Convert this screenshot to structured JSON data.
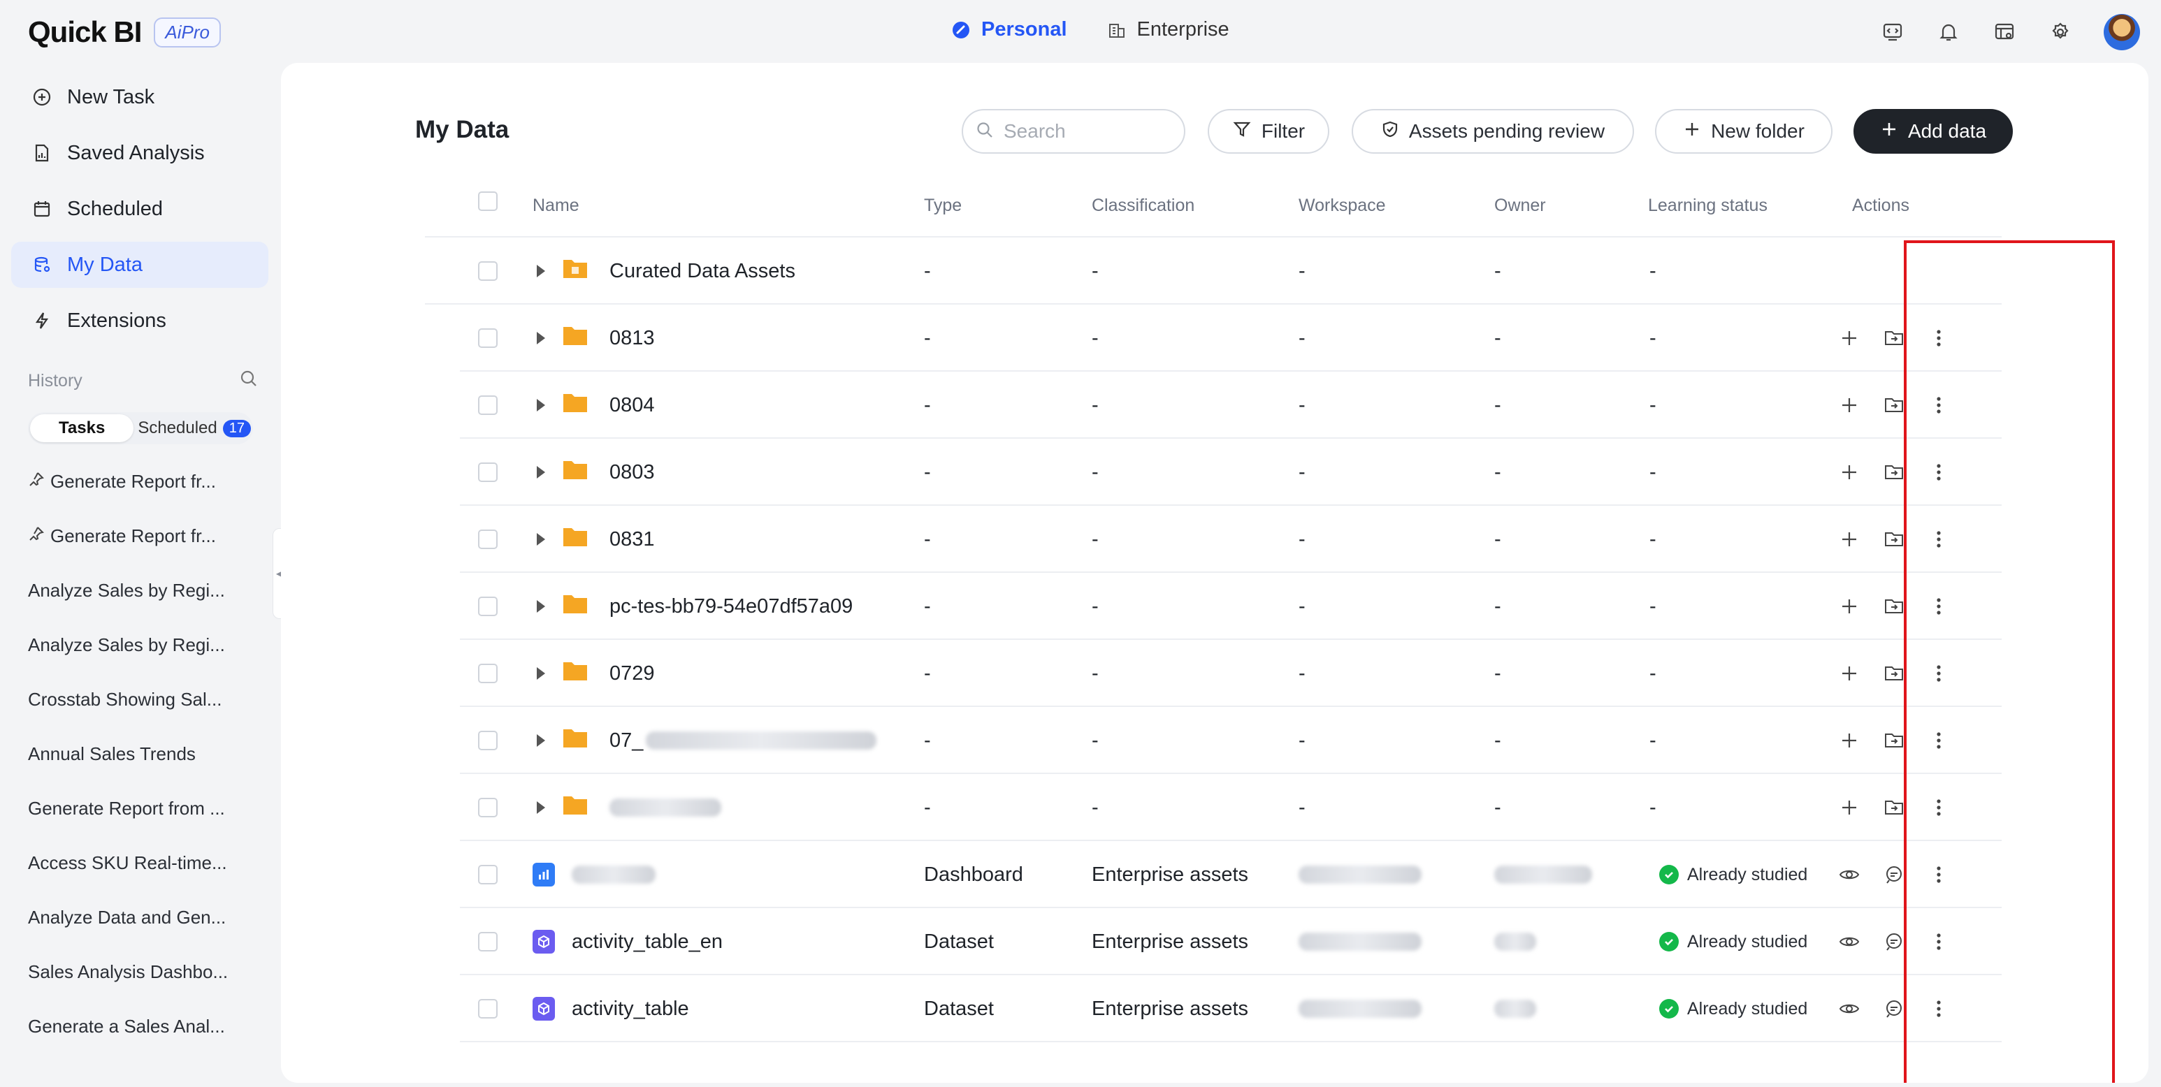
{
  "app": {
    "logo": "Quick BI",
    "badge": "AiPro"
  },
  "modes": [
    {
      "label": "Personal",
      "active": true
    },
    {
      "label": "Enterprise",
      "active": false
    }
  ],
  "top_icons": [
    "code-screen-icon",
    "bell-icon",
    "dashboard-settings-icon",
    "gear-icon"
  ],
  "sidebar": {
    "nav": [
      {
        "label": "New Task",
        "icon": "plus-circle-icon"
      },
      {
        "label": "Saved Analysis",
        "icon": "document-icon"
      },
      {
        "label": "Scheduled",
        "icon": "calendar-icon"
      },
      {
        "label": "My Data",
        "icon": "database-icon",
        "active": true
      },
      {
        "label": "Extensions",
        "icon": "bolt-icon"
      }
    ],
    "history_label": "History",
    "tabs": {
      "tasks": "Tasks",
      "scheduled": "Scheduled",
      "scheduled_count": "17"
    },
    "history": [
      {
        "label": "Generate Report fr...",
        "pinned": true
      },
      {
        "label": "Generate Report fr...",
        "pinned": true
      },
      {
        "label": "Analyze Sales by Regi..."
      },
      {
        "label": "Analyze Sales by Regi..."
      },
      {
        "label": "Crosstab Showing Sal..."
      },
      {
        "label": "Annual Sales Trends"
      },
      {
        "label": "Generate Report from ..."
      },
      {
        "label": "Access SKU Real-time..."
      },
      {
        "label": "Analyze Data and Gen..."
      },
      {
        "label": "Sales Analysis Dashbo..."
      },
      {
        "label": "Generate a Sales Anal..."
      }
    ]
  },
  "main": {
    "title": "My Data",
    "search_placeholder": "Search",
    "filter": "Filter",
    "pending": "Assets pending review",
    "new_folder": "New folder",
    "add_data": "Add data",
    "columns": [
      "Name",
      "Type",
      "Classification",
      "Workspace",
      "Owner",
      "Learning status",
      "Actions"
    ],
    "rows": [
      {
        "name": "Curated Data Assets",
        "kind": "folder-special",
        "type": "-",
        "classification": "-",
        "workspace": "-",
        "owner": "-",
        "status": "-"
      },
      {
        "name": "0813",
        "kind": "folder",
        "type": "-",
        "classification": "-",
        "workspace": "-",
        "owner": "-",
        "status": "-"
      },
      {
        "name": "0804",
        "kind": "folder",
        "type": "-",
        "classification": "-",
        "workspace": "-",
        "owner": "-",
        "status": "-"
      },
      {
        "name": "0803",
        "kind": "folder",
        "type": "-",
        "classification": "-",
        "workspace": "-",
        "owner": "-",
        "status": "-"
      },
      {
        "name": "0831",
        "kind": "folder",
        "type": "-",
        "classification": "-",
        "workspace": "-",
        "owner": "-",
        "status": "-"
      },
      {
        "name": "pc-tes-bb79-54e07df57a09",
        "kind": "folder",
        "type": "-",
        "classification": "-",
        "workspace": "-",
        "owner": "-",
        "status": "-"
      },
      {
        "name": "0729",
        "kind": "folder",
        "type": "-",
        "classification": "-",
        "workspace": "-",
        "owner": "-",
        "status": "-"
      },
      {
        "name": "07_",
        "kind": "folder",
        "type": "-",
        "classification": "-",
        "workspace": "-",
        "owner": "-",
        "status": "-"
      },
      {
        "name": "",
        "kind": "folder",
        "type": "-",
        "classification": "-",
        "workspace": "-",
        "owner": "-",
        "status": "-"
      },
      {
        "name": "",
        "kind": "dashboard",
        "type": "Dashboard",
        "classification": "Enterprise assets",
        "workspace": "",
        "owner": "",
        "status": "Already studied"
      },
      {
        "name": "activity_table_en",
        "kind": "dataset",
        "type": "Dataset",
        "classification": "Enterprise assets",
        "workspace": "",
        "owner": "",
        "status": "Already studied"
      },
      {
        "name": "activity_table",
        "kind": "dataset",
        "type": "Dataset",
        "classification": "Enterprise assets",
        "workspace": "",
        "owner": "",
        "status": "Already studied"
      }
    ]
  },
  "colors": {
    "accent": "#2456f5",
    "folder": "#f5a623",
    "success": "#14b84a",
    "highlight": "#e0151b"
  }
}
